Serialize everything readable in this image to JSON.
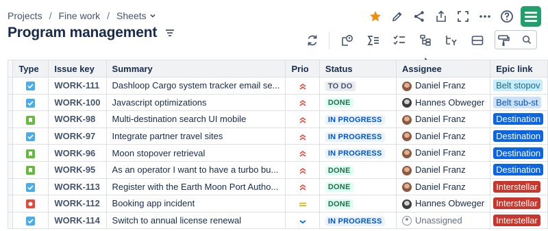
{
  "breadcrumb": {
    "items": [
      "Projects",
      "Fine work",
      "Sheets"
    ]
  },
  "page": {
    "title": "Program management"
  },
  "top_icons": [
    "star-icon",
    "pencil-icon",
    "share-icon",
    "export-icon",
    "fullscreen-icon",
    "more-icon",
    "help-icon",
    "app-logo-icon"
  ],
  "toolbar_icons": [
    "refresh-icon",
    "link-issue-icon",
    "sum-icon",
    "checklist-icon",
    "hierarchy-icon",
    "sort-icon",
    "row-height-icon",
    "paint-format-icon"
  ],
  "search": {
    "placeholder": ""
  },
  "table": {
    "columns": [
      "",
      "Type",
      "Issue key",
      "Summary",
      "Prio",
      "Status",
      "Assignee",
      "Epic link"
    ],
    "rows": [
      {
        "type": "task",
        "key": "WORK-111",
        "summary": "Dashloop Cargo system tracker email se...",
        "prio": "high",
        "status": "TO DO",
        "status_kind": "todo",
        "assignee": "Daniel Franz",
        "avatar": "daniel",
        "epic": "Belt stopov",
        "epic_style": "lightteal"
      },
      {
        "type": "task",
        "key": "WORK-100",
        "summary": "Javascript optimizations",
        "prio": "high",
        "status": "DONE",
        "status_kind": "done",
        "assignee": "Hannes Obweger",
        "avatar": "hannes",
        "epic": "Belt sub-st",
        "epic_style": "light"
      },
      {
        "type": "story",
        "key": "WORK-98",
        "summary": "Multi-destination search UI mobile",
        "prio": "high",
        "status": "IN PROGRESS",
        "status_kind": "prog",
        "assignee": "Daniel Franz",
        "avatar": "daniel",
        "epic": "Destination",
        "epic_style": "blue"
      },
      {
        "type": "task",
        "key": "WORK-97",
        "summary": "Integrate partner travel sites",
        "prio": "high",
        "status": "IN PROGRESS",
        "status_kind": "prog",
        "assignee": "Daniel Franz",
        "avatar": "daniel",
        "epic": "Destination",
        "epic_style": "blue"
      },
      {
        "type": "story",
        "key": "WORK-96",
        "summary": "Moon stopover retrieval",
        "prio": "high",
        "status": "IN PROGRESS",
        "status_kind": "prog",
        "assignee": "Daniel Franz",
        "avatar": "daniel",
        "epic": "Destination",
        "epic_style": "blue"
      },
      {
        "type": "story",
        "key": "WORK-95",
        "summary": "As an operator I want to have a turbo bu...",
        "prio": "high",
        "status": "DONE",
        "status_kind": "done",
        "assignee": "Daniel Franz",
        "avatar": "daniel",
        "epic": "Destination",
        "epic_style": "blue"
      },
      {
        "type": "task",
        "key": "WORK-113",
        "summary": "Register with the Earth Moon Port Autho...",
        "prio": "high",
        "status": "DONE",
        "status_kind": "done",
        "assignee": "Daniel Franz",
        "avatar": "daniel",
        "epic": "Interstellar",
        "epic_style": "red"
      },
      {
        "type": "bug",
        "key": "WORK-112",
        "summary": "Booking app incident",
        "prio": "medium",
        "status": "DONE",
        "status_kind": "done",
        "assignee": "Hannes Obweger",
        "avatar": "hannes",
        "epic": "Interstellar",
        "epic_style": "red"
      },
      {
        "type": "task",
        "key": "WORK-114",
        "summary": "Switch to annual license renewal",
        "prio": "low",
        "status": "IN PROGRESS",
        "status_kind": "prog",
        "assignee": "Unassigned",
        "avatar": "none",
        "epic": "Interstellar",
        "epic_style": "red"
      }
    ]
  }
}
